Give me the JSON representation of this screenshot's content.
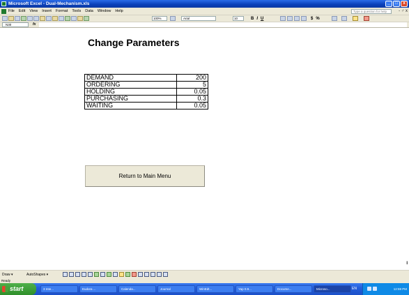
{
  "window": {
    "title": "Microsoft Excel - Dual-Mechanism.xls",
    "buttons": [
      "_",
      "□",
      "x"
    ]
  },
  "menu": {
    "items": [
      "File",
      "Edit",
      "View",
      "Insert",
      "Format",
      "Tools",
      "Data",
      "Window",
      "Help"
    ],
    "help_placeholder": "Type a question for help",
    "doc_controls": "- ♂ x"
  },
  "toolbar": {
    "zoom": "100%",
    "font": "Arial",
    "font_size": "10",
    "bold": "B",
    "italic": "I",
    "underline": "U",
    "currency": "$",
    "percent": "%"
  },
  "formula_bar": {
    "cell": "N30",
    "fx": "fx",
    "value": ""
  },
  "sheet": {
    "title": "Change Parameters",
    "params": [
      {
        "label": "DEMAND",
        "value": "200"
      },
      {
        "label": "ORDERING",
        "value": "5"
      },
      {
        "label": "HOLDING",
        "value": "0.05"
      },
      {
        "label": "PURCHASING",
        "value": "0.3"
      },
      {
        "label": "WAITING",
        "value": "0.05"
      }
    ],
    "return_button": "Return to Main Menu",
    "corner_mark": "I"
  },
  "drawing": {
    "draw_label": "Draw ▾",
    "autoshapes_label": "AutoShapes ▾"
  },
  "status": "Ready",
  "taskbar": {
    "start_label": "start",
    "tasks": [
      "3 Inte...",
      "Eudora ...",
      "Calenda...",
      "Journal",
      "WinEdt...",
      "Yap 0.9...",
      "Docume...",
      "Microso..."
    ],
    "language": "EN",
    "clock": "12:59 PM"
  }
}
